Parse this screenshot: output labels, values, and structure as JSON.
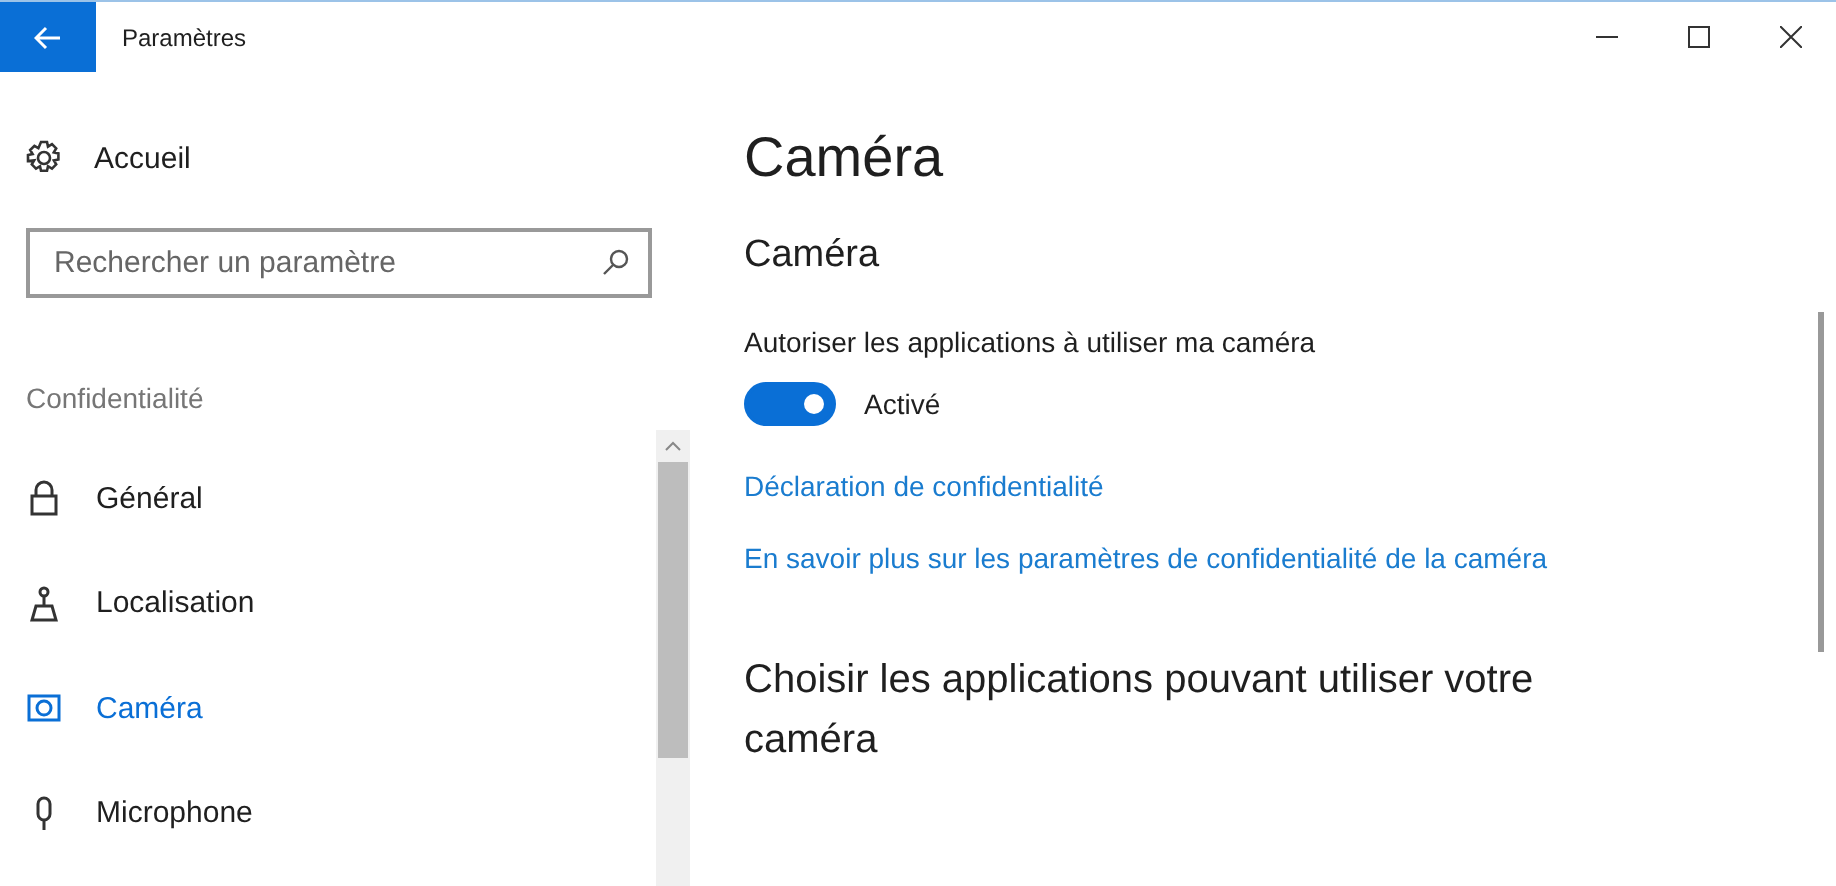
{
  "window": {
    "title": "Paramètres"
  },
  "sidebar": {
    "home": "Accueil",
    "search": {
      "placeholder": "Rechercher un paramètre"
    },
    "section": "Confidentialité",
    "items": [
      {
        "label": "Général",
        "kind": "lock",
        "selected": false
      },
      {
        "label": "Localisation",
        "kind": "location",
        "selected": false
      },
      {
        "label": "Caméra",
        "kind": "camera",
        "selected": true
      },
      {
        "label": "Microphone",
        "kind": "microphone",
        "selected": false
      }
    ]
  },
  "content": {
    "title": "Caméra",
    "section_title": "Caméra",
    "setting": {
      "label": "Autoriser les applications à utiliser ma caméra",
      "on": true,
      "state_text": "Activé"
    },
    "links": [
      "Déclaration de confidentialité",
      "En savoir plus sur les paramètres de confidentialité de la caméra"
    ],
    "apps_heading": "Choisir les applications pouvant utiliser votre caméra"
  }
}
